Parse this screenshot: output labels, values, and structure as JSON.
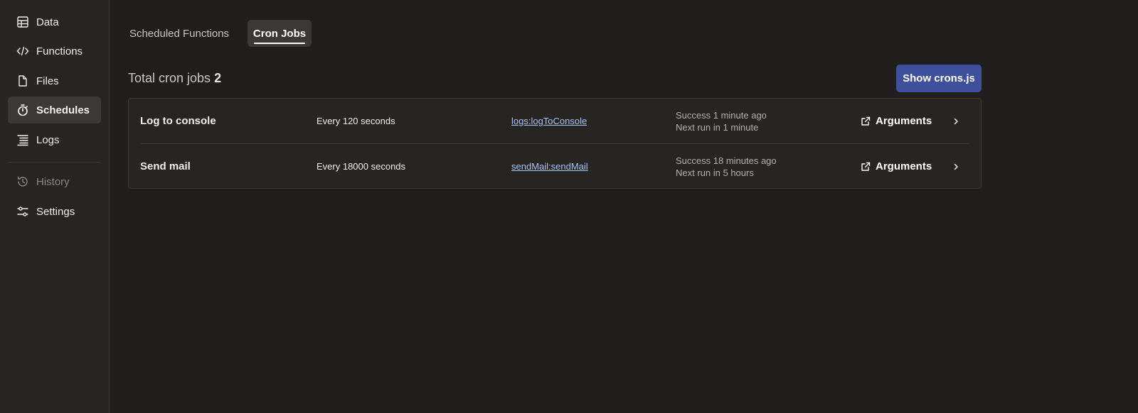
{
  "sidebar": {
    "items": [
      {
        "label": "Data",
        "icon": "table-icon"
      },
      {
        "label": "Functions",
        "icon": "code-icon"
      },
      {
        "label": "Files",
        "icon": "file-icon"
      },
      {
        "label": "Schedules",
        "icon": "stopwatch-icon",
        "active": true
      },
      {
        "label": "Logs",
        "icon": "list-icon"
      },
      {
        "label": "History",
        "icon": "history-icon",
        "disabled": true
      },
      {
        "label": "Settings",
        "icon": "sliders-icon"
      }
    ]
  },
  "tabs": {
    "scheduled": "Scheduled Functions",
    "cron": "Cron Jobs"
  },
  "header": {
    "total_label": "Total cron jobs",
    "total_count": "2",
    "show_button": "Show crons.js"
  },
  "jobs": [
    {
      "name": "Log to console",
      "schedule": "Every 120 seconds",
      "function": "logs:logToConsole",
      "status": "Success 1 minute ago",
      "next_run": "Next run in 1 minute",
      "args_label": "Arguments"
    },
    {
      "name": "Send mail",
      "schedule": "Every 18000 seconds",
      "function": "sendMail:sendMail",
      "status": "Success 18 minutes ago",
      "next_run": "Next run in 5 hours",
      "args_label": "Arguments"
    }
  ],
  "colors": {
    "accent": "#3e4f9b",
    "link": "#a9c2f5",
    "background": "#1f1e1d",
    "sidebar": "#262522"
  }
}
